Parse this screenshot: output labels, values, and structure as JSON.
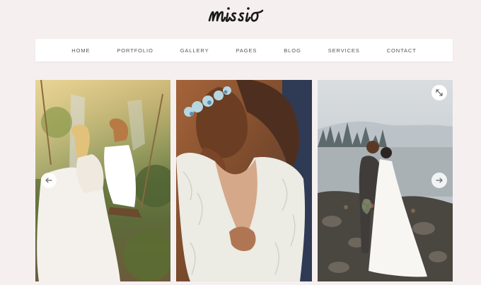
{
  "brand": {
    "logo_text": "missio"
  },
  "nav": {
    "items": [
      {
        "label": "HOME"
      },
      {
        "label": "PORTFOLIO"
      },
      {
        "label": "GALLERY"
      },
      {
        "label": "PAGES"
      },
      {
        "label": "BLOG"
      },
      {
        "label": "SERVICES"
      },
      {
        "label": "CONTACT"
      }
    ]
  },
  "gallery": {
    "slides": [
      {
        "subject": "bride-and-groom-on-swing-by-waterfall"
      },
      {
        "subject": "couple-embrace-lace-back-dress-flower-crown"
      },
      {
        "subject": "couple-kissing-by-misty-lake"
      }
    ],
    "controls": {
      "prev_icon": "arrow-left-icon",
      "next_icon": "arrow-right-icon",
      "expand_icon": "expand-icon"
    }
  },
  "colors": {
    "background": "#f6eff0",
    "nav_bg": "#ffffff",
    "nav_text": "#555555",
    "logo": "#1a1a1a"
  }
}
